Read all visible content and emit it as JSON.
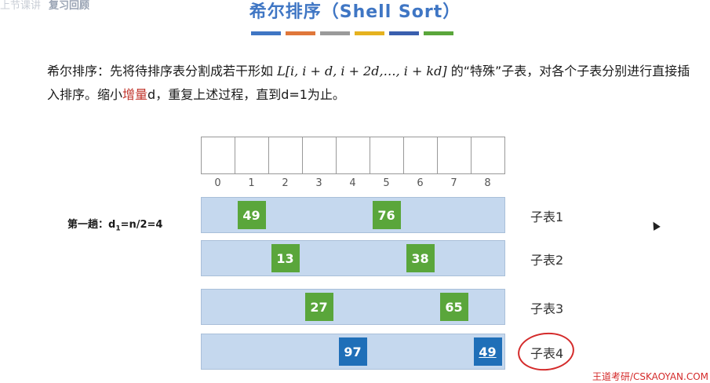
{
  "header": {
    "corner_text": "上节课讲",
    "corner_blur": "复习回顾",
    "title": "希尔排序（Shell Sort）",
    "color_bar": [
      "#3f76c4",
      "#e0773a",
      "#9a9a9a",
      "#e5b21f",
      "#3a5fae",
      "#5aa63b"
    ]
  },
  "description": {
    "part1": "希尔排序：先将待排序表分割成若干形如 ",
    "formula": "L[i, i + d, i + 2d,…, i + kd]",
    "part2": " 的“特殊”子表，对各个子表分别进行直接插入排序。缩小",
    "highlight": "增量",
    "part3": "d，重复上述过程，直到d=1为止。"
  },
  "array": {
    "indices": [
      "0",
      "1",
      "2",
      "3",
      "4",
      "5",
      "6",
      "7",
      "8"
    ]
  },
  "pass": {
    "label_prefix": "第一趟：d",
    "label_sub": "1",
    "label_suffix": "=n/2=4"
  },
  "subtables": [
    {
      "label": "子表1",
      "cells": [
        {
          "index": 1,
          "value": "49",
          "color": "green"
        },
        {
          "index": 5,
          "value": "76",
          "color": "green"
        }
      ]
    },
    {
      "label": "子表2",
      "cells": [
        {
          "index": 2,
          "value": "13",
          "color": "green"
        },
        {
          "index": 6,
          "value": "38",
          "color": "green"
        }
      ]
    },
    {
      "label": "子表3",
      "cells": [
        {
          "index": 3,
          "value": "27",
          "color": "green"
        },
        {
          "index": 7,
          "value": "65",
          "color": "green"
        }
      ]
    },
    {
      "label": "子表4",
      "cells": [
        {
          "index": 4,
          "value": "97",
          "color": "blue"
        },
        {
          "index": 8,
          "value": "49",
          "color": "blue",
          "underline": true
        }
      ],
      "circled": true
    }
  ],
  "watermark": "王道考研/CSKAOYAN.COM"
}
